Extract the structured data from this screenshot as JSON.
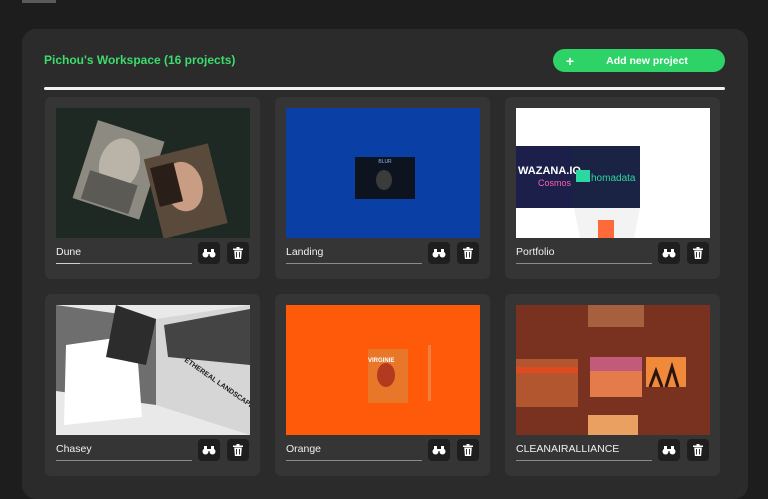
{
  "workspace": {
    "title": "Pichou's Workspace (16 projects)"
  },
  "actions": {
    "add_label": "Add new project",
    "add_icon": "+"
  },
  "colors": {
    "accent": "#2ed367",
    "title": "#3ddc6e",
    "panel": "#2b2b2b",
    "card": "#353535"
  },
  "projects": [
    {
      "name": "Dune",
      "thumb_bg": "#1f2924",
      "progress": 0.18
    },
    {
      "name": "Landing",
      "thumb_bg": "#0a3fa6",
      "thumb_text": "BLUR",
      "progress": 0
    },
    {
      "name": "Portfolio",
      "thumb_bg": "#ffffff",
      "thumb_text_1": "WAZANA.IO",
      "thumb_text_2": "Cosmos",
      "thumb_text_3": "homadata",
      "progress": 0
    },
    {
      "name": "Chasey",
      "thumb_bg": "#e9e9e9",
      "thumb_text": "ETHEREAL LANDSCAPES",
      "progress": 0
    },
    {
      "name": "Orange",
      "thumb_bg": "#ff5a0a",
      "thumb_text": "VIRGINIE",
      "progress": 0
    },
    {
      "name": "CLEANAIRALLIANCE",
      "thumb_bg": "#7a3220",
      "progress": 0
    }
  ],
  "icons": {
    "view": "binoculars-icon",
    "delete": "trash-icon"
  }
}
